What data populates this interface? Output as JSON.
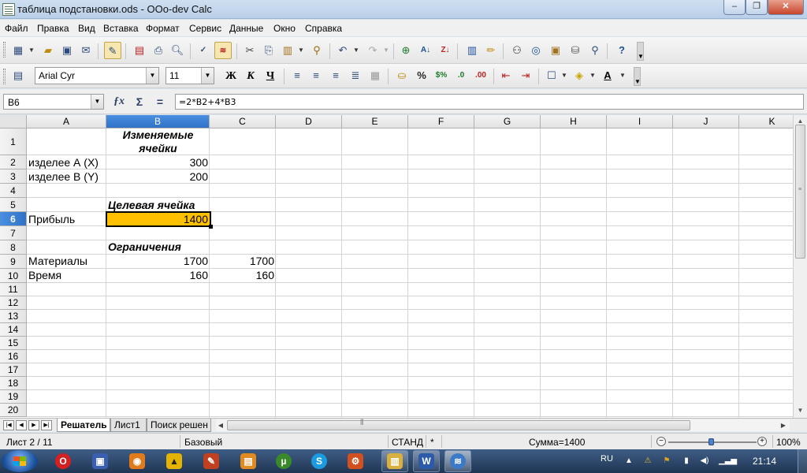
{
  "window": {
    "title": "таблица подстановки.ods - OOo-dev Calc"
  },
  "menu": [
    "Файл",
    "Правка",
    "Вид",
    "Вставка",
    "Формат",
    "Сервис",
    "Данные",
    "Окно",
    "Справка"
  ],
  "format_toolbar": {
    "font_name": "Arial Cyr",
    "font_size": "11",
    "bold_label": "Ж",
    "italic_label": "К",
    "underline_label": "Ч"
  },
  "formula_bar": {
    "cell_ref": "B6",
    "formula": "=2*B2+4*B3"
  },
  "grid": {
    "columns": [
      "A",
      "B",
      "C",
      "D",
      "E",
      "F",
      "G",
      "H",
      "I",
      "J",
      "K"
    ],
    "selected_column": "B",
    "rows": [
      "1",
      "2",
      "3",
      "4",
      "5",
      "6",
      "7",
      "8",
      "9",
      "10",
      "11",
      "12",
      "13",
      "14",
      "15",
      "16",
      "17",
      "18",
      "19",
      "20"
    ],
    "selected_row": "6",
    "cells": {
      "B1": "Изменяемые ячейки",
      "A2": "изделее А (X)",
      "B2": "300",
      "A3": "изделее В (Y)",
      "B3": "200",
      "B5": "Целевая ячейка",
      "A6": "Прибыль",
      "B6": "1400",
      "B8": "Ограничения",
      "A9": "Материалы",
      "B9": "1700",
      "C9": "1700",
      "A10": "Время",
      "B10": "160",
      "C10": "160"
    },
    "highlight_color": "#ffc000"
  },
  "sheet_tabs": [
    "Решатель",
    "Лист1",
    "Поиск решен"
  ],
  "active_sheet": "Решатель",
  "status_bar": {
    "sheet": "Лист 2 / 11",
    "style": "Базовый",
    "mode": "СТАНД",
    "modified": "*",
    "sum": "Сумма=1400",
    "zoom": "100%"
  },
  "taskbar": {
    "language": "RU",
    "time": "21:14"
  }
}
